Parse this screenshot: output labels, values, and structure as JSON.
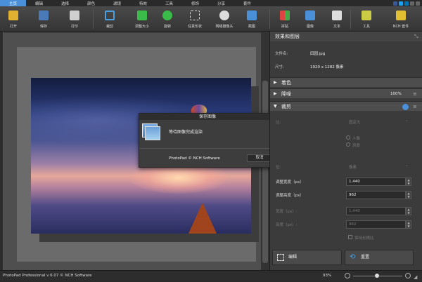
{
  "menu": {
    "items": [
      "主页",
      "编辑",
      "选择",
      "颜色",
      "滤镜",
      "特效",
      "工具",
      "修饰",
      "分享",
      "套件"
    ]
  },
  "toolbar": {
    "open": "打开",
    "save": "保存",
    "print": "打印",
    "crop": "裁剪",
    "resize": "调整大小",
    "rotate": "旋转",
    "freeform": "任意形状",
    "webcam": "网络摄像头",
    "screenshot": "截图",
    "collage": "拼贴",
    "image": "图像",
    "text": "文本",
    "tools": "工具",
    "suite": "NCH 套件"
  },
  "dialog": {
    "title": "保存图像",
    "message": "等待图像完成渲染",
    "copyright": "PhotoPad © NCH Software",
    "cancel": "取消"
  },
  "panel": {
    "header": "效果和图层",
    "filename_label": "文件名:",
    "filename": "田园.jpg",
    "size_label": "尺寸:",
    "size": "1920 x 1282 像素",
    "sections": {
      "color": "着色",
      "noise": "降噪",
      "noise_pct": "100%",
      "crop": "裁剪"
    },
    "crop": {
      "ratio_label": "比:",
      "ratio_value": "固定大",
      "landscape": "人像",
      "portrait": "风景",
      "units_label": "位:",
      "units_value": "像素",
      "adj_width_label": "调整宽度（px）",
      "adj_width": "1,440",
      "adj_height_label": "调整高度（px）",
      "adj_height": "962",
      "width_label": "宽度（px）:",
      "width": "1,440",
      "height_label": "高度（px）:",
      "height": "962",
      "keep_label": "保持长横比"
    },
    "edit_button": "编辑",
    "reset_button": "重置"
  },
  "status": {
    "app": "PhotoPad Professional v 6.07 © NCH Software",
    "zoom": "93%"
  },
  "colors": {
    "accent": "#4a90d9",
    "menu_bg": "#2a2a2a",
    "panel_bg": "#3b3b3b"
  }
}
